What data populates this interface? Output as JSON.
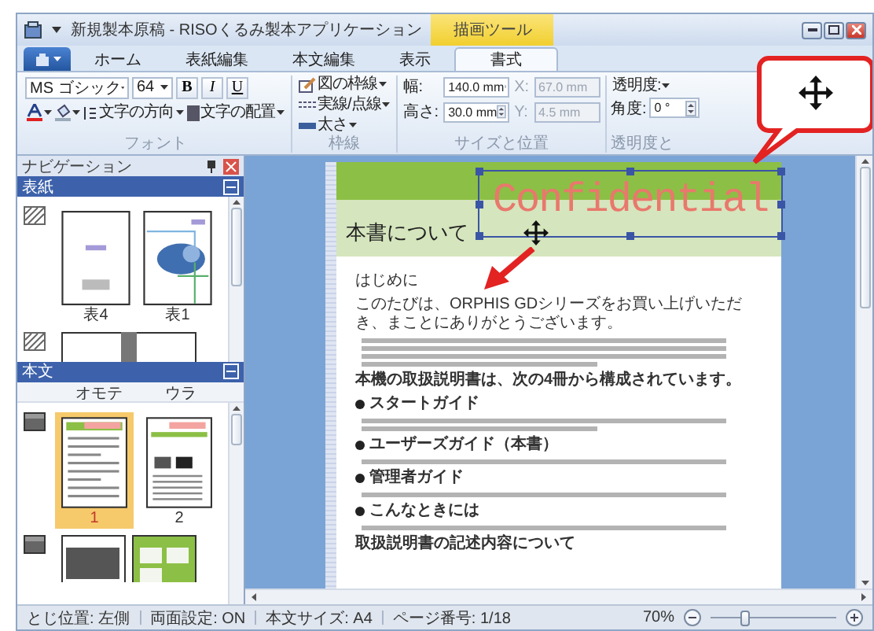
{
  "window": {
    "title": "新規製本原稿 - RISOくるみ製本アプリケーション",
    "context_tab": "描画ツール"
  },
  "tabs": [
    {
      "label": "ホーム",
      "selected": false
    },
    {
      "label": "表紙編集",
      "selected": false
    },
    {
      "label": "本文編集",
      "selected": false
    },
    {
      "label": "表示",
      "selected": false
    },
    {
      "label": "書式",
      "selected": true
    }
  ],
  "ribbon": {
    "font": {
      "name": "MS ゴシック",
      "size": "64",
      "styles": [
        {
          "kind": "bold",
          "label": "B"
        },
        {
          "kind": "italic",
          "label": "I"
        },
        {
          "kind": "underline",
          "label": "U"
        }
      ],
      "direction": "文字の方向",
      "align": "文字の配置",
      "group_label": "フォント"
    },
    "border": {
      "items": [
        {
          "kind": "outline",
          "label": "図の枠線"
        },
        {
          "kind": "dash",
          "label": "実線/点線"
        },
        {
          "kind": "weight",
          "label": "太さ"
        }
      ],
      "group_label": "枠線"
    },
    "size": {
      "fields": [
        {
          "label": "幅:",
          "value": "140.0 mm",
          "disabled": false
        },
        {
          "label": "高さ:",
          "value": "30.0 mm",
          "disabled": false
        },
        {
          "label": "X:",
          "value": "67.0 mm",
          "disabled": true
        },
        {
          "label": "Y:",
          "value": "4.5 mm",
          "disabled": true
        }
      ],
      "group_label": "サイズと位置"
    },
    "transparency": {
      "label": "透明度:",
      "angle_label": "角度:",
      "angle": "0 °",
      "group_label": "透明度と"
    }
  },
  "navigation": {
    "title": "ナビゲーション",
    "cover": {
      "title": "表紙",
      "expanded": true,
      "pages": [
        {
          "label": "表4",
          "selected": false
        },
        {
          "label": "表1",
          "selected": false
        }
      ]
    },
    "body": {
      "title": "本文",
      "expanded": true,
      "columns": [
        "オモテ",
        "ウラ"
      ],
      "pages": [
        {
          "label": "1",
          "selected": true
        },
        {
          "label": "2",
          "selected": false
        }
      ]
    }
  },
  "document": {
    "heading": "本書について",
    "watermark": "Confidential",
    "blocks": [
      {
        "kind": "heading",
        "text": "はじめに"
      },
      {
        "kind": "para",
        "text": "このたびは、ORPHIS GDシリーズをお買い上げいただき、まことにありがとうございます。"
      },
      {
        "kind": "bold",
        "text": "本機の取扱説明書は、次の4冊から構成されています。"
      },
      {
        "kind": "bullet",
        "text": "スタートガイド"
      },
      {
        "kind": "bullet",
        "text": "ユーザーズガイド（本書）"
      },
      {
        "kind": "bullet",
        "text": "管理者ガイド"
      },
      {
        "kind": "bullet",
        "text": "こんなときには"
      },
      {
        "kind": "bold",
        "text": "取扱説明書の記述内容について"
      }
    ]
  },
  "status_bar": {
    "items": [
      "とじ位置: 左側",
      "両面設定: ON",
      "本文サイズ: A4",
      "ページ番号: 1/18"
    ],
    "zoom": "70%",
    "zoom_level": {
      "level": 0.28
    }
  }
}
